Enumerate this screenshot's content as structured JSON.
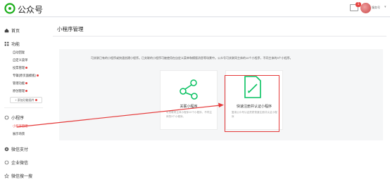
{
  "header": {
    "brand": "公众号",
    "badge_count": "1",
    "username": "服务号"
  },
  "sidebar": {
    "home": "首页",
    "feature": "功能",
    "feature_items": [
      {
        "label": "自动回复",
        "dot": false
      },
      {
        "label": "自定义菜单",
        "dot": false
      },
      {
        "label": "投票管理",
        "dot": true
      },
      {
        "label": "专辑(原页面模板)",
        "dot": true
      },
      {
        "label": "管理功能",
        "dot": true
      },
      {
        "label": "原创管理",
        "dot": true
      }
    ],
    "add_plugin": "添加功能插件",
    "miniprogram": "小程序",
    "mini_items": [
      {
        "label": "小程序管理",
        "active": true
      },
      {
        "label": "展示场景",
        "active": false
      }
    ],
    "wechat_pay": "微信支付",
    "enterprise_wechat": "企业微信",
    "search": "微信搜一搜"
  },
  "main": {
    "title": "小程序管理",
    "description": "可关联已有的小程序或快速创建小程序。已关联的小程序可被使用在自定义菜单和模版消息等场景中。公众号可关联同主体的10个小程序，不同主体的3个小程序。",
    "cards": [
      {
        "title": "关联小程序",
        "desc": "可关联同主体小程序10个小程序，不同主体的3个小程序。"
      },
      {
        "title": "快速注册并认证小程序",
        "desc": "复用公众号认证资质快速注册并认证小程序"
      }
    ]
  },
  "colors": {
    "accent_green": "#07c160",
    "highlight_red": "#e53a3a"
  }
}
